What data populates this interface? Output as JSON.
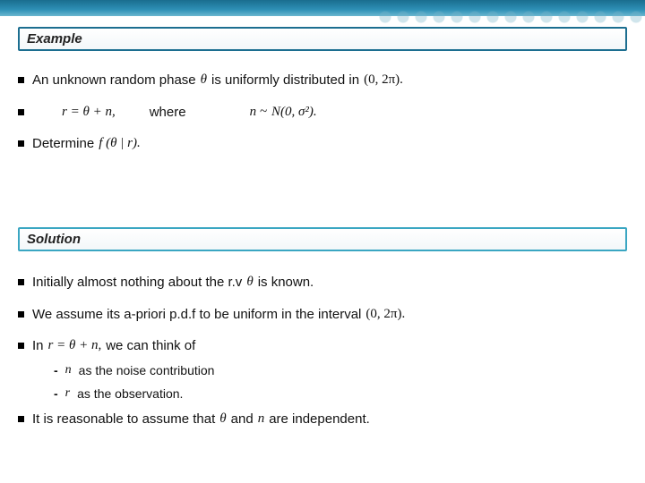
{
  "headings": {
    "example": "Example",
    "solution": "Solution"
  },
  "upper": {
    "l1a": "An unknown random phase",
    "theta": "θ",
    "l1b": "is uniformly distributed in",
    "interval": "(0, 2π).",
    "eq_r": "r = θ + n,",
    "where": "where",
    "n_tilde": "n ~",
    "normal": "N(0, σ²).",
    "determine": "Determine",
    "posterior": "f (θ | r)."
  },
  "lower": {
    "l1a": "Initially almost nothing about the r.v",
    "theta": "θ",
    "l1b": "is known.",
    "l2a": "We assume its a-priori p.d.f to be uniform in the interval",
    "interval": "(0, 2π).",
    "in_word": "In",
    "eq_r": "r = θ + n,",
    "think": "we can think of",
    "dash_n_var": "n",
    "dash_n_txt": "as the noise contribution",
    "dash_r_var": "r",
    "dash_r_txt": "as the observation.",
    "l5a": "It is reasonable to assume that",
    "and_word": "and",
    "n_var": "n",
    "l5b": "are independent."
  }
}
